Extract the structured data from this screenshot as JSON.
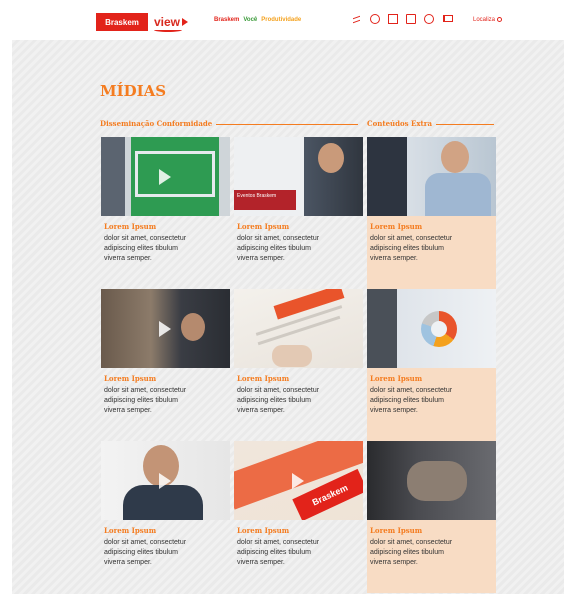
{
  "header": {
    "logo_text": "Braskem",
    "view_logo_text": "view",
    "nav": [
      {
        "label": "Braskem",
        "color": "#e2231a"
      },
      {
        "label": "Você",
        "color": "#3b9b3a"
      },
      {
        "label": "Produtividade",
        "color": "#f4a11d"
      }
    ],
    "icons": [
      "share-icon",
      "chat-icon",
      "news-icon",
      "edit-icon",
      "globe-icon",
      "flag-icon"
    ],
    "locale_label": "Localiza"
  },
  "page": {
    "title": "MÍDIAS",
    "section_left": "Disseminação Conformidade",
    "section_right": "Conteúdos Extra"
  },
  "colors": {
    "accent": "#f47c20",
    "brand_red": "#e2231a",
    "extra_column_bg": "#f8dcc4"
  },
  "cards": [
    {
      "title": "Lorem Ipsum",
      "lines": [
        "dolor sit amet, consectetur",
        "adipiscing elites tibulum",
        "viverra semper."
      ],
      "has_play": true
    },
    {
      "title": "Lorem Ipsum",
      "lines": [
        "dolor sit amet, consectetur",
        "adipiscing elites tibulum",
        "viverra semper."
      ],
      "has_play": false,
      "banner": "Eventos Braskem"
    },
    {
      "title": "Lorem Ipsum",
      "lines": [
        "dolor sit amet, consectetur",
        "adipiscing elites tibulum",
        "viverra semper."
      ],
      "has_play": false
    },
    {
      "title": "Lorem Ipsum",
      "lines": [
        "dolor sit amet, consectetur",
        "adipiscing elites tibulum",
        "viverra semper."
      ],
      "has_play": true
    },
    {
      "title": "Lorem Ipsum",
      "lines": [
        "dolor sit amet, consectetur",
        "adipiscing elites tibulum",
        "viverra semper."
      ],
      "has_play": false
    },
    {
      "title": "Lorem Ipsum",
      "lines": [
        "dolor sit amet, consectetur",
        "adipiscing elites tibulum",
        "viverra semper."
      ],
      "has_play": false
    },
    {
      "title": "Lorem Ipsum",
      "lines": [
        "dolor sit amet, consectetur",
        "adipiscing elites tibulum",
        "viverra semper."
      ],
      "has_play": true
    },
    {
      "title": "Lorem Ipsum",
      "lines": [
        "dolor sit amet, consectetur",
        "adipiscing elites tibulum",
        "viverra semper."
      ],
      "has_play": true,
      "tag": "Braskem"
    },
    {
      "title": "Lorem Ipsum",
      "lines": [
        "dolor sit amet, consectetur",
        "adipiscing elites tibulum",
        "viverra semper."
      ],
      "has_play": false
    }
  ]
}
